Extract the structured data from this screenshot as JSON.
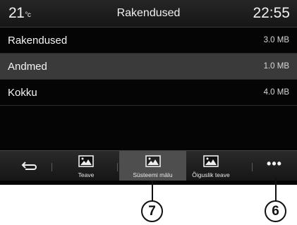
{
  "status": {
    "temperature": "21",
    "temperature_unit": "°c",
    "title": "Rakendused",
    "clock": "22:55"
  },
  "rows": [
    {
      "label": "Rakendused",
      "value": "3.0 MB",
      "selected": false
    },
    {
      "label": "Andmed",
      "value": "1.0 MB",
      "selected": true
    },
    {
      "label": "Kokku",
      "value": "4.0 MB",
      "selected": false
    }
  ],
  "tabs": [
    {
      "label": "Teave",
      "icon": "image-icon",
      "active": false
    },
    {
      "label": "Süsteemi mälu",
      "icon": "image-icon",
      "active": true
    },
    {
      "label": "Õiguslik teave",
      "icon": "image-icon",
      "active": false
    }
  ],
  "buttons": {
    "back_icon": "back-arrow-icon",
    "more_label": "•••"
  },
  "callouts": {
    "system_memory": "7",
    "more": "6"
  }
}
